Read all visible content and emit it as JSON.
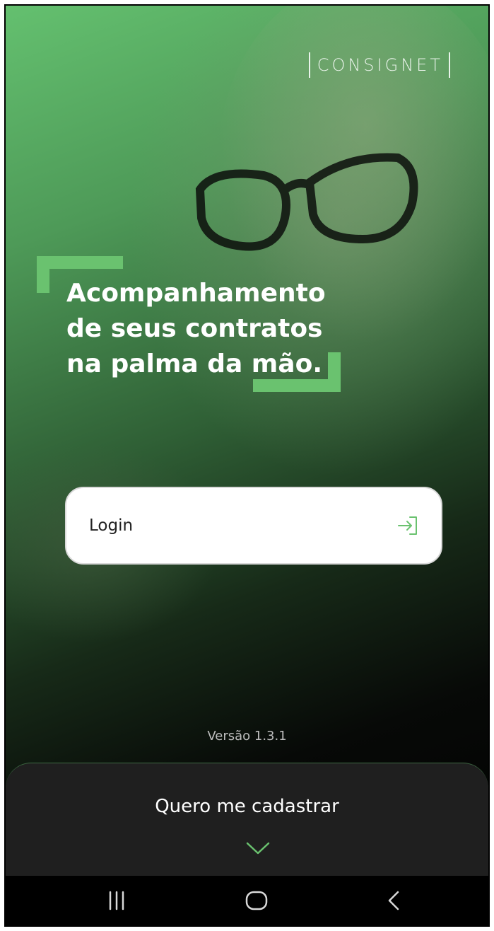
{
  "brand": {
    "logo_text": "CONSIGNET"
  },
  "hero": {
    "line1": "Acompanhamento",
    "line2": "de seus contratos",
    "line3": "na palma da mão."
  },
  "login": {
    "label": "Login",
    "icon": "login-arrow-icon"
  },
  "version": "Versão 1.3.1",
  "register_sheet": {
    "label": "Quero me cadastrar",
    "icon": "chevron-down-icon"
  },
  "system_nav": {
    "recents": "recent-apps-icon",
    "home": "home-icon",
    "back": "back-icon"
  },
  "colors": {
    "accent": "#6ac26f",
    "sheet_bg": "#1f1f1f",
    "button_bg": "#ffffff"
  }
}
